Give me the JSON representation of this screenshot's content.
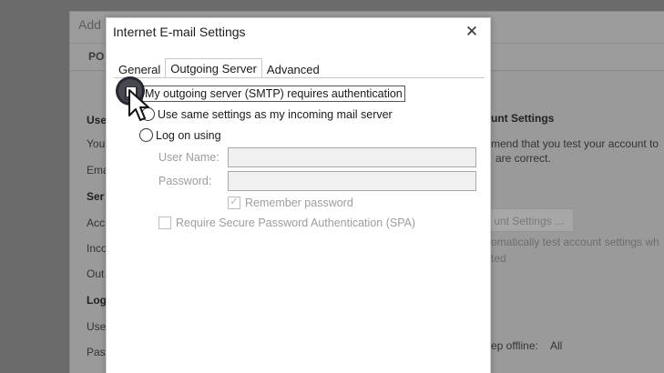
{
  "background_window": {
    "title": "Add",
    "tab_label": "PO",
    "left_texts": [
      {
        "text": "Use",
        "bold": true
      },
      {
        "text": "You",
        "bold": false
      },
      {
        "text": "Ema",
        "bold": false
      },
      {
        "text": "Ser",
        "bold": true
      },
      {
        "text": "Acc",
        "bold": false
      },
      {
        "text": "Inco",
        "bold": false
      },
      {
        "text": "Out",
        "bold": false
      },
      {
        "text": "Log",
        "bold": true
      },
      {
        "text": "Use",
        "bold": false
      },
      {
        "text": "Pas",
        "bold": false
      }
    ],
    "right_heading": "unt Settings",
    "right_line1": "mend that you test your account to",
    "right_line2": "are correct.",
    "test_button_label": "unt Settings ...",
    "auto_test_line1": "omatically test account settings wh",
    "auto_test_line2": "ted",
    "offline_label": "ep offline:",
    "offline_value": "All"
  },
  "dialog": {
    "title": "Internet E-mail Settings",
    "close_glyph": "✕",
    "tabs": [
      {
        "label": "General",
        "active": false
      },
      {
        "label": "Outgoing Server",
        "active": true
      },
      {
        "label": "Advanced",
        "active": false
      }
    ],
    "smtp_auth_label": "My outgoing server (SMTP) requires authentication",
    "use_same_label": "Use same settings as my incoming mail server",
    "log_on_label": "Log on using",
    "user_name_label": "User Name:",
    "user_name_value": "",
    "password_label": "Password:",
    "password_value": "",
    "remember_label": "Remember password",
    "spa_label": "Require Secure Password Authentication (SPA)"
  },
  "icons": {
    "close": "close-icon",
    "cursor": "mouse-pointer-icon",
    "check": "checkmark-icon"
  }
}
